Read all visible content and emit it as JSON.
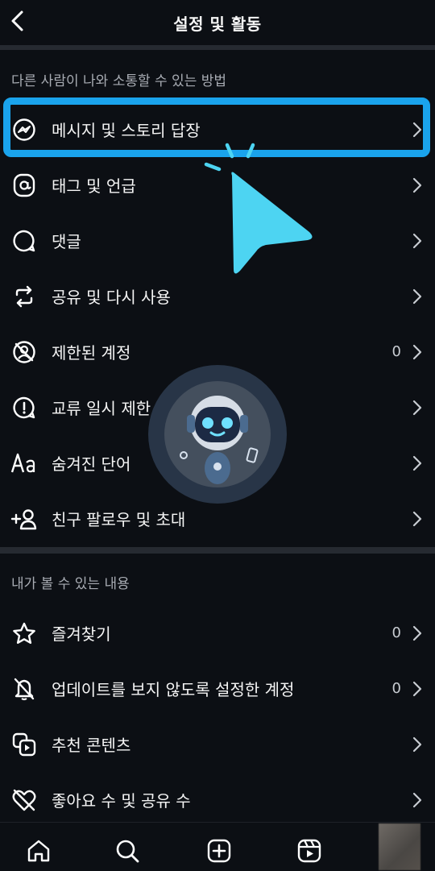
{
  "header": {
    "title": "설정 및 활동"
  },
  "section1": {
    "title": "다른 사람이 나와 소통할 수 있는 방법",
    "items": [
      {
        "label": "메시지 및 스토리 답장",
        "icon": "messenger-icon",
        "count": ""
      },
      {
        "label": "태그 및 언급",
        "icon": "at-icon",
        "count": ""
      },
      {
        "label": "댓글",
        "icon": "comment-icon",
        "count": ""
      },
      {
        "label": "공유 및 다시 사용",
        "icon": "repost-icon",
        "count": ""
      },
      {
        "label": "제한된 계정",
        "icon": "restricted-icon",
        "count": "0"
      },
      {
        "label": "교류 일시 제한",
        "icon": "alert-bubble-icon",
        "count": ""
      },
      {
        "label": "숨겨진 단어",
        "icon": "text-aa-icon",
        "count": ""
      },
      {
        "label": "친구 팔로우 및 초대",
        "icon": "add-person-icon",
        "count": ""
      }
    ]
  },
  "section2": {
    "title": "내가 볼 수 있는 내용",
    "items": [
      {
        "label": "즐겨찾기",
        "icon": "star-icon",
        "count": "0"
      },
      {
        "label": "업데이트를 보지 않도록 설정한 계정",
        "icon": "muted-bell-icon",
        "count": "0"
      },
      {
        "label": "추천 콘텐츠",
        "icon": "suggested-content-icon",
        "count": ""
      },
      {
        "label": "좋아요 수 및 공유 수",
        "icon": "heart-off-icon",
        "count": ""
      }
    ]
  },
  "bottom_nav": [
    "home-icon",
    "search-icon",
    "create-icon",
    "reels-icon",
    "profile-avatar"
  ],
  "colors": {
    "background": "#0c0f14",
    "highlight": "#1aa3ec",
    "cursor": "#4dd4f2"
  }
}
